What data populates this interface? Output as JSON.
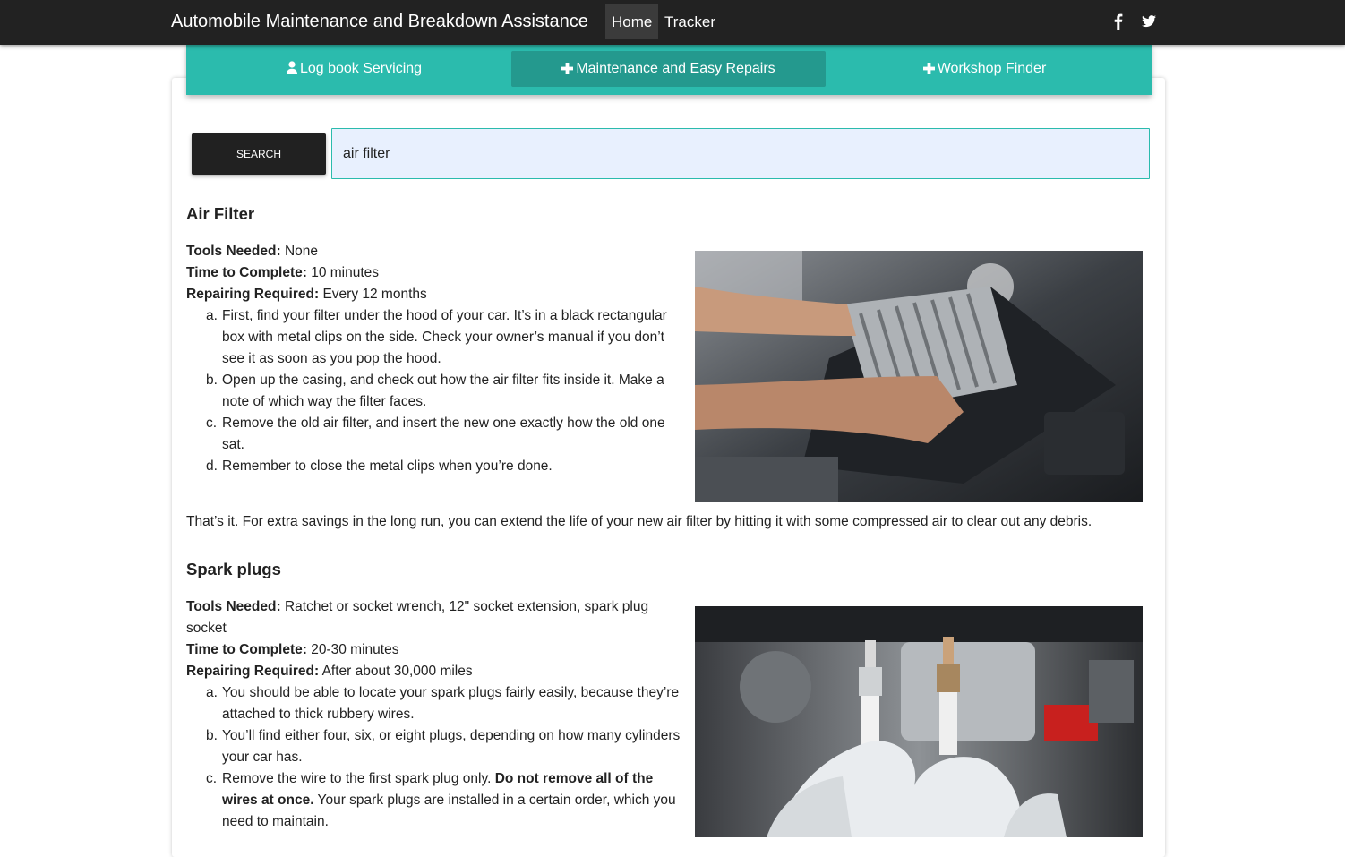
{
  "navbar": {
    "title": "Automobile Maintenance and Breakdown Assistance",
    "links": [
      {
        "label": "Home",
        "active": true
      },
      {
        "label": "Tracker",
        "active": false
      }
    ],
    "social_icons": [
      "facebook-icon",
      "twitter-icon"
    ]
  },
  "tabs": [
    {
      "label": "Log book Servicing",
      "icon": "user-icon",
      "active": false
    },
    {
      "label": "Maintenance and Easy Repairs",
      "icon": "plus-icon",
      "active": true
    },
    {
      "label": "Workshop Finder",
      "icon": "plus-icon",
      "active": false
    }
  ],
  "search": {
    "button_label": "SEARCH",
    "value": "air filter"
  },
  "sections": [
    {
      "title": "Air Filter",
      "fields": [
        {
          "label": "Tools Needed:",
          "value": " None"
        },
        {
          "label": "Time to Complete:",
          "value": " 10 minutes"
        },
        {
          "label": "Repairing Required:",
          "value": " Every 12 months"
        }
      ],
      "steps": [
        {
          "marker": "a.",
          "text": "First, find your filter under the hood of your car. It’s in a black rectangular box with metal clips on the side. Check your owner’s manual if you don’t see it as soon as you pop the hood."
        },
        {
          "marker": "b.",
          "text": "Open up the casing, and check out how the air filter fits inside it. Make a note of which way the filter faces."
        },
        {
          "marker": "c.",
          "text": "Remove the old air filter, and insert the new one exactly how the old one sat."
        },
        {
          "marker": "d.",
          "text": "Remember to close the metal clips when you’re done."
        }
      ],
      "footer": "That’s it. For extra savings in the long run, you can extend the life of your new air filter by hitting it with some compressed air to clear out any debris."
    },
    {
      "title": "Spark plugs",
      "fields": [
        {
          "label": "Tools Needed:",
          "value": " Ratchet or socket wrench, 12\" socket extension, spark plug socket"
        },
        {
          "label": "Time to Complete:",
          "value": " 20-30 minutes"
        },
        {
          "label": "Repairing Required:",
          "value": " After about 30,000 miles"
        }
      ],
      "steps": [
        {
          "marker": "a.",
          "text": "You should be able to locate your spark plugs fairly easily, because they’re attached to thick rubbery wires."
        },
        {
          "marker": "b.",
          "text": "You’ll find either four, six, or eight plugs, depending on how many cylinders your car has."
        },
        {
          "marker": "c.",
          "pre": "Remove the wire to the first spark plug only. ",
          "bold": "Do not remove all of the wires at once.",
          "post": " Your spark plugs are installed in a certain order, which you need to maintain."
        }
      ]
    }
  ],
  "colors": {
    "navbar": "#222222",
    "tabbar": "#2bbbad",
    "tab_active": "#24998e",
    "search_button": "#212121",
    "input_bg": "#e8f0fe"
  }
}
